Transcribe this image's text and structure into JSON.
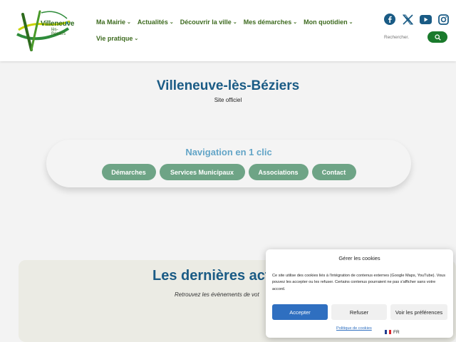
{
  "header": {
    "logo": {
      "name": "Villeneuve",
      "sub": "lès-Béziers"
    },
    "nav": {
      "row1": [
        "Ma Mairie",
        "Actualités",
        "Découvrir la ville",
        "Mes démarches",
        "Mon quotidien"
      ],
      "row2": [
        "Vie pratique"
      ]
    },
    "socials": [
      "facebook-icon",
      "x-icon",
      "youtube-icon",
      "instagram-icon"
    ],
    "search": {
      "placeholder": "Rechercher."
    }
  },
  "hero": {
    "title": "Villeneuve-lès-Béziers",
    "subtitle": "Site officiel"
  },
  "quick_nav": {
    "title": "Navigation en 1 clic",
    "buttons": [
      "Démarches",
      "Services Municipaux",
      "Associations",
      "Contact"
    ]
  },
  "news": {
    "title": "Les dernières actu",
    "subtitle": "Retrouvez les évènements de vot"
  },
  "cookie": {
    "title": "Gérer les cookies",
    "text": "Ce site utilise des cookies liés à l'intégration de contenus externes (Google Maps, YouTube). Vous pouvez les accepter ou les refuser. Certains contenus pourraient ne pas s'afficher sans votre accord.",
    "accept": "Accepter",
    "refuse": "Refuser",
    "prefs": "Voir les préférences",
    "policy": "Politique de cookies"
  },
  "lang": {
    "code": "FR"
  },
  "colors": {
    "nav": "#3d6a1e",
    "title_blue": "#1a5b85",
    "quick_title": "#63a5c7",
    "button_green": "#6ea486",
    "accept_blue": "#2f6fc0",
    "search_green": "#1a7a2c"
  }
}
